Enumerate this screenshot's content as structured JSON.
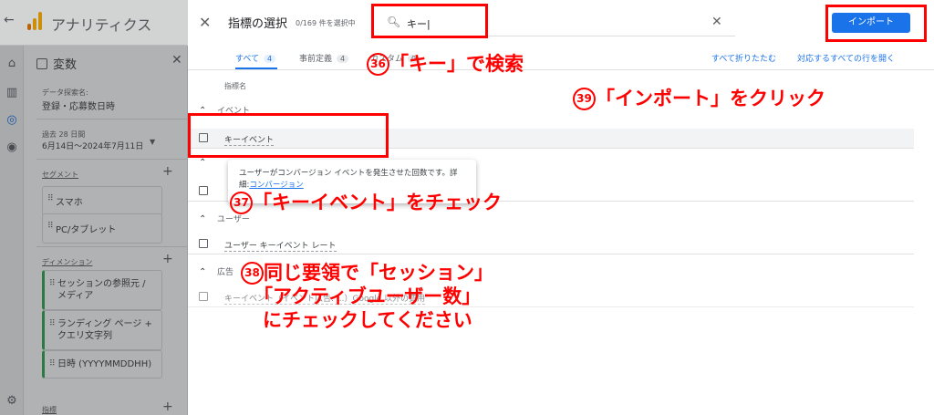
{
  "header": {
    "back_icon": "arrow-left-icon",
    "app_title": "アナリティクス",
    "brand_colors": [
      "#f9ab00",
      "#e37400"
    ]
  },
  "rail": {
    "icons": [
      "home-icon",
      "reports-icon",
      "explore-icon",
      "advertising-icon",
      "settings-icon"
    ]
  },
  "variables_panel": {
    "title": "変数",
    "data_name_label": "データ探索名:",
    "data_name_value": "登録・応募数日時",
    "date_range_label": "過去 28 日間",
    "date_range_value": "6月14日～2024年7月11日",
    "segments_label": "セグメント",
    "segments": [
      "スマホ",
      "PC/タブレット"
    ],
    "dimensions_label": "ディメンション",
    "dimensions": [
      "セッションの参照元 / メディア",
      "ランディング ページ + クエリ文字列",
      "日時 (YYYYMMDDHH)"
    ],
    "metrics_label": "指標"
  },
  "dialog": {
    "title": "指標の選択",
    "selected_count": "0/169 件を選択中",
    "search_value": "キー|",
    "import_label": "インポート",
    "tabs": [
      {
        "label": "すべて",
        "count": "4"
      },
      {
        "label": "事前定義",
        "count": "4"
      },
      {
        "label": "カスタム",
        "count": "0"
      }
    ],
    "collapse_all": "すべて折りたたむ",
    "expand_all": "対応するすべての行を開く",
    "column_header": "指標名",
    "groups": [
      {
        "label": "イベント"
      },
      {
        "label": ""
      },
      {
        "label": "ユーザー"
      },
      {
        "label": "広告"
      }
    ],
    "rows": [
      {
        "label": "キーイベント"
      },
      {
        "label": ""
      },
      {
        "label": "ユーザー キーイベント レート"
      },
      {
        "label": "キーイベント（イベント広告: ...）Google 以外の費用"
      }
    ],
    "tooltip_text": "ユーザーがコンバージョン イベントを発生させた回数です。詳細:",
    "tooltip_link": "コンバージョン",
    "accent": "#1a73e8"
  },
  "annotations": {
    "color": "#ff0000",
    "a36": {
      "num": "36",
      "text": "「キー」で検索"
    },
    "a39": {
      "num": "39",
      "text": "「インポート」をクリック"
    },
    "a37": {
      "num": "37",
      "text": "「キーイベント」をチェック"
    },
    "a38": {
      "num": "38",
      "line1": "同じ要領で「セッション」",
      "line2": "「アクティブユーザー数」",
      "line3": "にチェックしてください"
    }
  }
}
